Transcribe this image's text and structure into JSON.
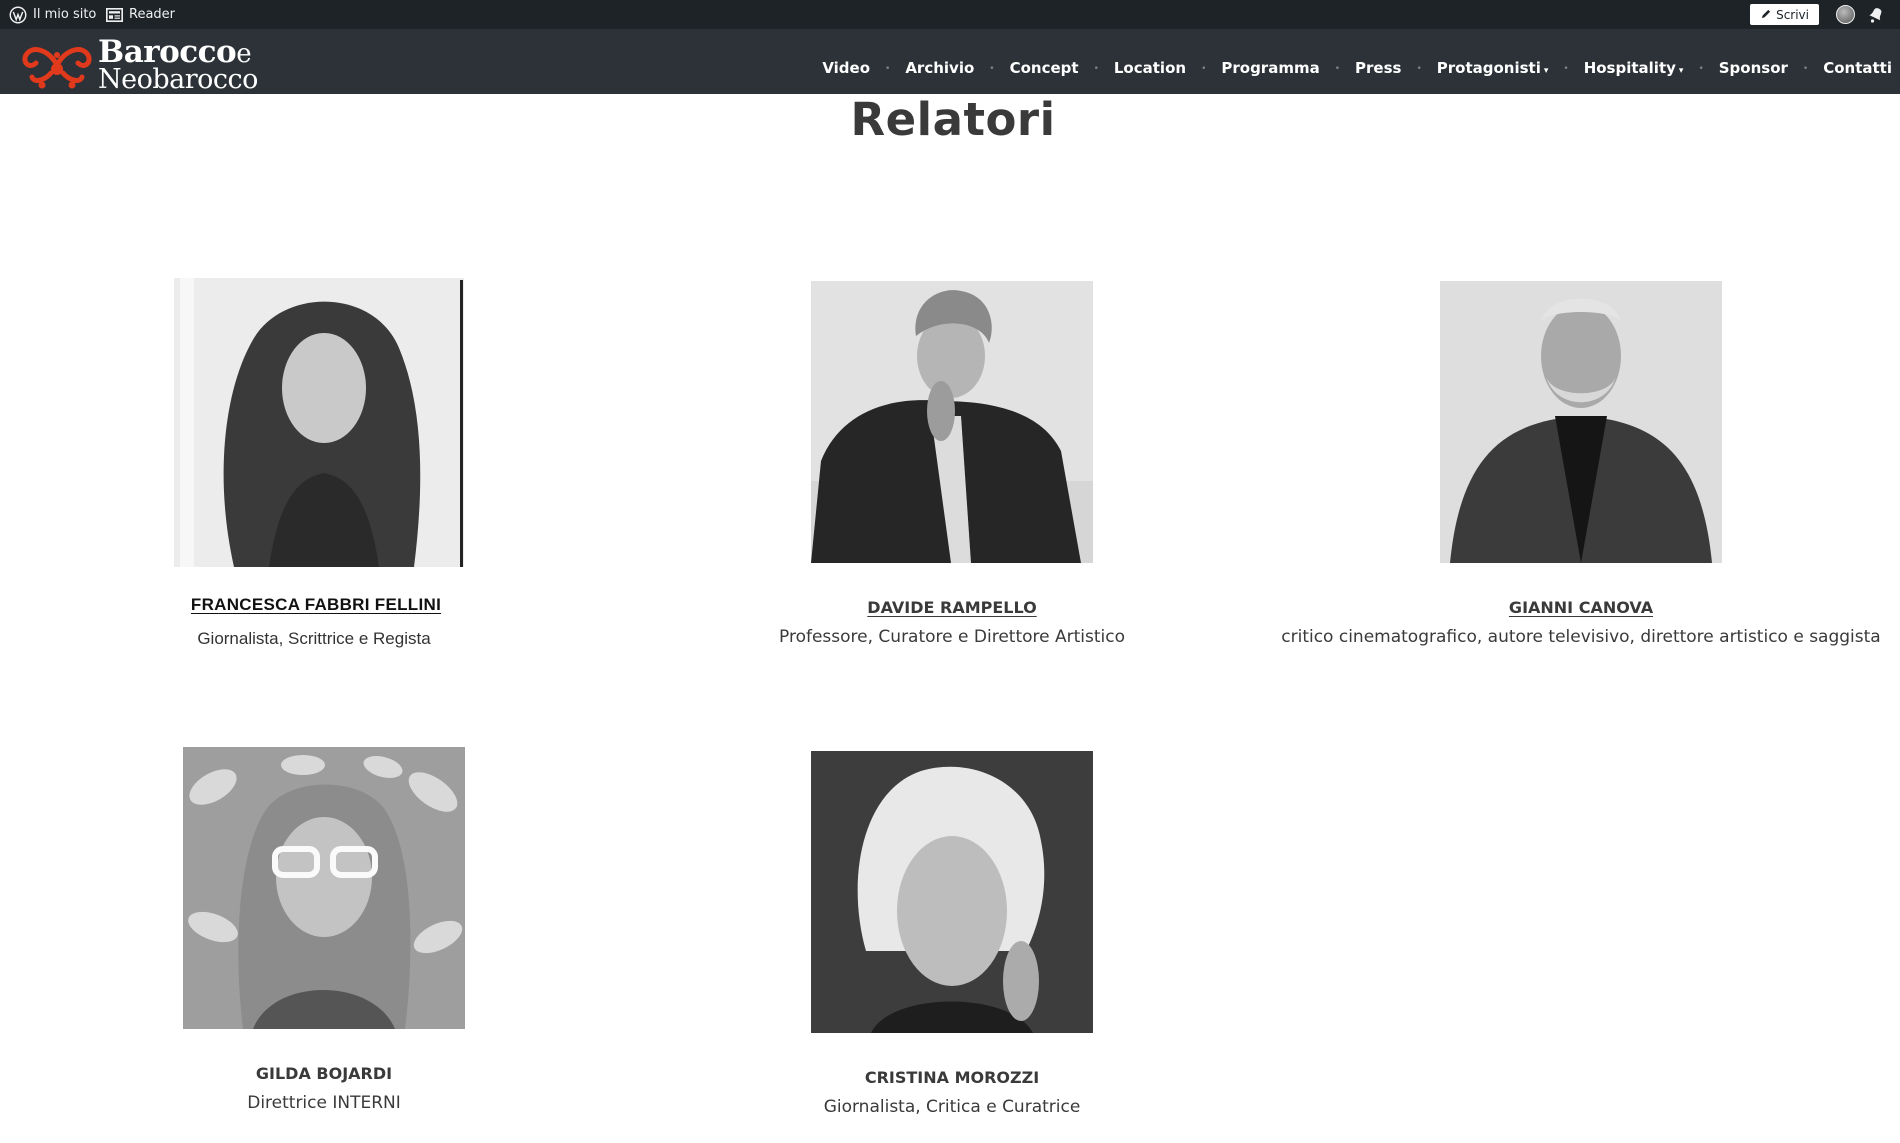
{
  "admin_bar": {
    "my_site": "Il mio sito",
    "reader": "Reader",
    "write": "Scrivi"
  },
  "site": {
    "logo_line1_a": "Barocco",
    "logo_line1_b": "e",
    "logo_line2": "Neobarocco",
    "brand_color": "#e0391c"
  },
  "nav": {
    "items": [
      {
        "label": "Video"
      },
      {
        "label": "Archivio"
      },
      {
        "label": "Concept"
      },
      {
        "label": "Location"
      },
      {
        "label": "Programma"
      },
      {
        "label": "Press"
      },
      {
        "label": "Protagonisti",
        "has_dropdown": true
      },
      {
        "label": "Hospitality",
        "has_dropdown": true
      },
      {
        "label": "Sponsor"
      },
      {
        "label": "Contatti"
      }
    ],
    "caret": "▾",
    "separator": "•"
  },
  "page": {
    "title": "Relatori"
  },
  "speakers": [
    {
      "name": "FRANCESCA FABBRI FELLINI",
      "role": "Giornalista, Scrittrice e Regista",
      "photo_icon": "portrait-woman-long-hair"
    },
    {
      "name": "DAVIDE RAMPELLO",
      "role": "Professore, Curatore e Direttore Artistico",
      "photo_icon": "portrait-man-curly-hair"
    },
    {
      "name": "GIANNI CANOVA",
      "role": "critico cinematografico, autore televisivo, direttore artistico e saggista",
      "photo_icon": "portrait-man-beard"
    },
    {
      "name": "GILDA BOJARDI",
      "role": "Direttrice INTERNI",
      "photo_icon": "portrait-woman-glasses-flowers"
    },
    {
      "name": "CRISTINA MOROZZI",
      "role": "Giornalista, Critica e Curatrice",
      "photo_icon": "portrait-woman-white-hair"
    }
  ]
}
